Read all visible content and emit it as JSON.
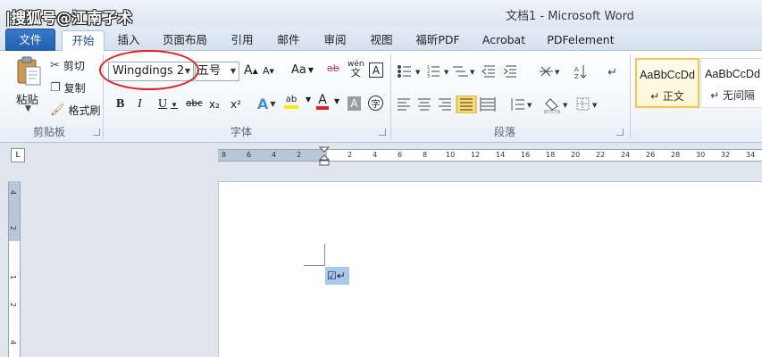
{
  "window": {
    "watermark": "|搜狐号@江南孑术",
    "title": "文档1 - Microsoft Word"
  },
  "tabs": [
    "文件",
    "开始",
    "插入",
    "页面布局",
    "引用",
    "邮件",
    "审阅",
    "视图",
    "福昕PDF",
    "Acrobat",
    "PDFelement"
  ],
  "clipboard": {
    "paste": "粘贴",
    "cut": "剪切",
    "copy": "复制",
    "format_painter": "格式刷",
    "group_label": "剪贴板"
  },
  "font": {
    "name": "Wingdings 2",
    "size": "五号",
    "grow": "A",
    "shrink": "A",
    "case": "Aa",
    "clear_format": "ab",
    "phonetic": "wén",
    "char_border": "A",
    "bold": "B",
    "italic": "I",
    "underline": "U",
    "strike": "abc",
    "subscript": "x₂",
    "superscript": "x²",
    "text_effects": "A",
    "highlight": "ab",
    "font_color": "A",
    "char_shading": "A",
    "enclose": "字",
    "group_label": "字体"
  },
  "paragraph": {
    "group_label": "段落"
  },
  "styles": {
    "items": [
      {
        "sample": "AaBbCcDd",
        "name": "↵ 正文"
      },
      {
        "sample": "AaBbCcDd",
        "name": "↵ 无间隔"
      }
    ]
  },
  "ruler": {
    "ticks": [
      "8",
      "6",
      "4",
      "2",
      "",
      "2",
      "4",
      "6",
      "8",
      "10",
      "12",
      "14",
      "16",
      "18",
      "20",
      "22",
      "24",
      "26",
      "28",
      "30",
      "32",
      "34"
    ],
    "vticks": [
      "4",
      "2",
      "1",
      "2",
      "4"
    ]
  },
  "document": {
    "selected_text": "☑↵"
  },
  "colors": {
    "file_tab": "#2a6bbf",
    "highlight_circle": "#e02020",
    "selection": "#a9c8ee"
  }
}
